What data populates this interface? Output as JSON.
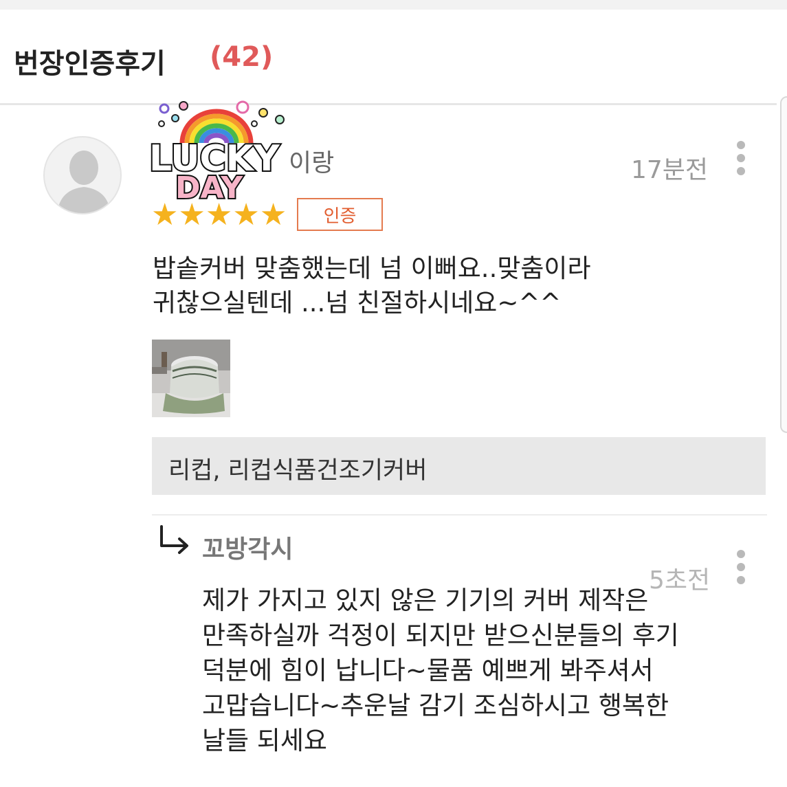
{
  "header": {
    "title": "번장인증후기",
    "count": "(42)"
  },
  "review": {
    "reviewer_name": "이랑",
    "sticker_text": [
      "LUCKY",
      "DAY"
    ],
    "time": "17분전",
    "rating": 5,
    "stars": "★★★★★",
    "badge": "인증",
    "text": "밥솥커버 맞춤했는데 넘  이뻐요..맞춤이라\n귀찮으실텐데 ...넘 친절하시네요~^^",
    "product": "리컵, 리컵식품건조기커버"
  },
  "reply": {
    "seller_name": "꼬방각시",
    "time": "5초전",
    "text": "제가 가지고 있지 않은 기기의 커버 제작은\n만족하실까 걱정이 되지만 받으신분들의 후기\n덕분에 힘이 납니다~물품 예쁘게 봐주셔서\n고맙습니다~추운날 감기 조심하시고 행복한\n날들 되세요"
  },
  "colors": {
    "accent_red": "#e05a5a",
    "star": "#f5b21e",
    "badge": "#e25d2f"
  },
  "icons": {
    "reply": "reply-arrow-icon",
    "more": "more-vertical-icon",
    "avatar": "default-avatar-icon"
  }
}
